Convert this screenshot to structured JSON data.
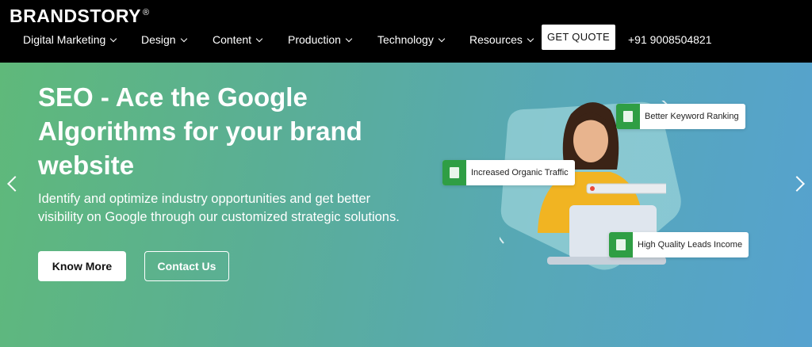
{
  "header": {
    "logo_text": "BRANDSTORY",
    "logo_mark": "®",
    "nav": [
      {
        "label": "Digital Marketing"
      },
      {
        "label": "Design"
      },
      {
        "label": "Content"
      },
      {
        "label": "Production"
      },
      {
        "label": "Technology"
      },
      {
        "label": "Resources"
      }
    ],
    "cta_label": "GET QUOTE",
    "phone": "+91 9008504821"
  },
  "hero": {
    "title": "SEO - Ace the Google Algorithms for your brand website",
    "subtitle": "Identify and optimize industry opportunities and get better visibility on Google through our customized strategic solutions.",
    "primary_button": "Know More",
    "secondary_button": "Contact Us",
    "badges": [
      {
        "label": "Better Keyword Ranking"
      },
      {
        "label": "Increased Organic Traffic"
      },
      {
        "label": "High Quality Leads Income"
      }
    ]
  },
  "colors": {
    "header_bg": "#000000",
    "hero_gradient_start": "#5fb97a",
    "hero_gradient_end": "#56a2cf",
    "badge_green": "#2f9e44"
  },
  "icons": [
    "chevron-down-icon",
    "chevron-left-icon",
    "chevron-right-icon",
    "document-icon",
    "chart-icon",
    "people-icon"
  ]
}
